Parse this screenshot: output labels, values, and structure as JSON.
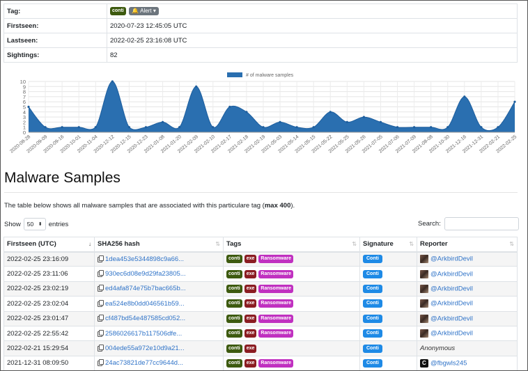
{
  "info": {
    "rows": [
      {
        "key": "Tag:",
        "value": ""
      },
      {
        "key": "Firstseen:",
        "value": "2020-07-23 12:45:05 UTC"
      },
      {
        "key": "Lastseen:",
        "value": "2022-02-25 23:16:08 UTC"
      },
      {
        "key": "Sightings:",
        "value": "82"
      }
    ],
    "tag_badge": "conti",
    "alert_label": "Alert",
    "alert_icon": "bell-icon"
  },
  "chart_data": {
    "type": "area",
    "legend": "# of malware samples",
    "legend_position": "top",
    "grid": true,
    "ylim": [
      0,
      10
    ],
    "yticks": [
      0,
      1,
      2,
      3,
      4,
      5,
      6,
      7,
      8,
      9,
      10
    ],
    "color": "#2a6fb0",
    "x": [
      "2020-08-28",
      "2020-09-09",
      "2020-09-16",
      "2020-10-01",
      "2020-11-04",
      "2020-12-12",
      "2020-12-15",
      "2020-12-23",
      "2021-01-08",
      "2021-01-20",
      "2021-02-09",
      "2021-02-10",
      "2021-02-17",
      "2021-02-18",
      "2021-02-19",
      "2021-05-03",
      "2021-05-14",
      "2021-05-15",
      "2021-05-22",
      "2021-05-25",
      "2021-05-26",
      "2021-07-05",
      "2021-07-06",
      "2021-07-09",
      "2021-08-08",
      "2021-10-30",
      "2021-12-16",
      "2021-12-31",
      "2022-02-21",
      "2022-02-25"
    ],
    "values": [
      5,
      1,
      1,
      1,
      1,
      10,
      1,
      1,
      2,
      1,
      9,
      1,
      5,
      4,
      1,
      2,
      1,
      1,
      4,
      2,
      3,
      2,
      1,
      1,
      1,
      1,
      7,
      1,
      1,
      6
    ]
  },
  "main": {
    "title": "Malware Samples",
    "desc_prefix": "The table below shows all malware samples that are associated with this particulare tag (",
    "desc_bold": "max 400",
    "desc_suffix": ").",
    "show_label": "Show",
    "show_value": "50",
    "entries_label": "entries",
    "search_label": "Search:"
  },
  "table": {
    "columns": [
      "Firstseen (UTC)",
      "SHA256 hash",
      "Tags",
      "Signature",
      "Reporter"
    ],
    "rows": [
      {
        "firstseen": "2022-02-25 23:16:09",
        "hash": "1dea453e5344898c9a66...",
        "tags": [
          "conti",
          "exe",
          "Ransomware"
        ],
        "signature": "Conti",
        "reporter": "@ArkbirdDevil"
      },
      {
        "firstseen": "2022-02-25 23:11:06",
        "hash": "930ec6d08e9d29fa23805...",
        "tags": [
          "conti",
          "exe",
          "Ransomware"
        ],
        "signature": "Conti",
        "reporter": "@ArkbirdDevil"
      },
      {
        "firstseen": "2022-02-25 23:02:19",
        "hash": "ed4afa874e75b7bac665b...",
        "tags": [
          "conti",
          "exe",
          "Ransomware"
        ],
        "signature": "Conti",
        "reporter": "@ArkbirdDevil"
      },
      {
        "firstseen": "2022-02-25 23:02:04",
        "hash": "ea524e8b0dd046561b59...",
        "tags": [
          "conti",
          "exe",
          "Ransomware"
        ],
        "signature": "Conti",
        "reporter": "@ArkbirdDevil"
      },
      {
        "firstseen": "2022-02-25 23:01:47",
        "hash": "cf487bd54e487585cd052...",
        "tags": [
          "conti",
          "exe",
          "Ransomware"
        ],
        "signature": "Conti",
        "reporter": "@ArkbirdDevil"
      },
      {
        "firstseen": "2022-02-25 22:55:42",
        "hash": "2586026617b117506dfe...",
        "tags": [
          "conti",
          "exe",
          "Ransomware"
        ],
        "signature": "Conti",
        "reporter": "@ArkbirdDevil"
      },
      {
        "firstseen": "2022-02-21 15:29:54",
        "hash": "004ede55a972e10d9a21...",
        "tags": [
          "conti",
          "exe"
        ],
        "signature": "Conti",
        "reporter": "Anonymous"
      },
      {
        "firstseen": "2021-12-31 08:09:50",
        "hash": "24ac73821de77cc9644d...",
        "tags": [
          "conti",
          "exe",
          "Ransomware"
        ],
        "signature": "Conti",
        "reporter": "@fbgwls245"
      }
    ]
  }
}
